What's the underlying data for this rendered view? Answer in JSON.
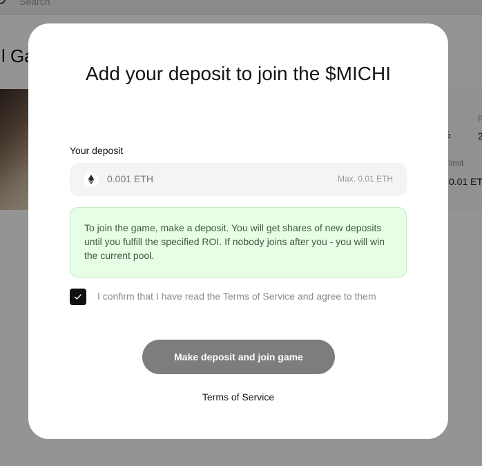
{
  "background": {
    "search_placeholder": "Search",
    "page_title": "l Ga",
    "stats": {
      "percent_fragment": "%",
      "right_label_fragment": "F",
      "right_value_fragment": "2",
      "limit_label": "limit",
      "limit_value": "0.01 ETI"
    }
  },
  "modal": {
    "title": "Add your deposit to join the $MICHI",
    "deposit": {
      "label": "Your deposit",
      "value": "0.001 ETH",
      "max_label": "Max. 0.01 ETH",
      "currency_icon": "ethereum-icon"
    },
    "info_text": "To join the game, make a deposit. You will get shares of new deposits until you fulfill the specified ROI. If nobody joins after you - you will win the current pool.",
    "confirm": {
      "checked": true,
      "text": "I confirm that I have read the Terms of Service and agree to them"
    },
    "submit_label": "Make deposit and join game",
    "tos_link": "Terms of Service"
  },
  "colors": {
    "overlay": "rgba(0,0,0,0.42)",
    "info_bg": "#e6fde6",
    "info_border": "#bfeec3",
    "button_bg": "#7d7d7d",
    "checkbox_bg": "#101010"
  }
}
